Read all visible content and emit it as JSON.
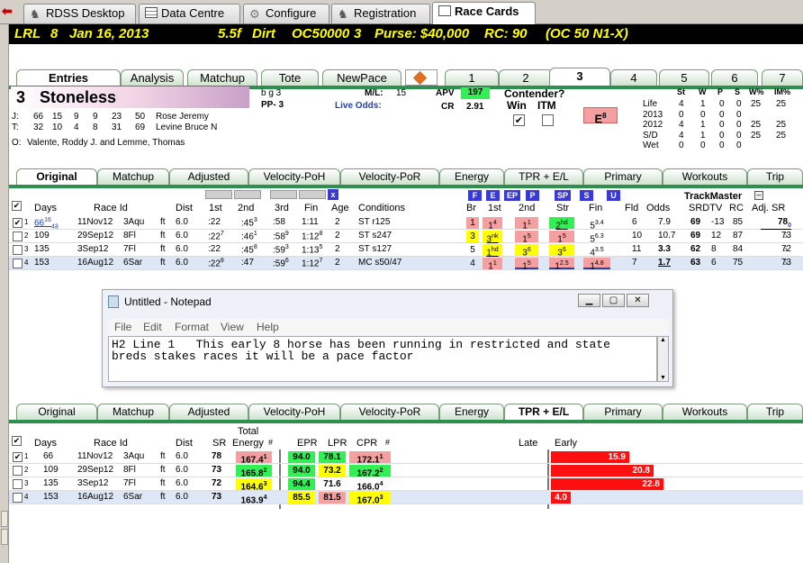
{
  "topTabs": [
    "RDSS Desktop",
    "Data Centre",
    "Configure",
    "Registration",
    "Race Cards"
  ],
  "header": {
    "track": "LRL",
    "race": "8",
    "date": "Jan 16, 2013",
    "dist": "5.5f",
    "surface": "Dirt",
    "cls": "OC50000",
    "num": "3",
    "purse": "Purse: $40,000",
    "rc": "RC: 90",
    "cond": "(OC 50 N1-X)"
  },
  "viewTabs": [
    "Entries",
    "Analysis",
    "Matchup",
    "Tote",
    "NewPace"
  ],
  "horseTabs": [
    "1",
    "2",
    "3",
    "4",
    "5",
    "6",
    "7"
  ],
  "horse": {
    "num": "3",
    "name": "Stoneless",
    "sex": "b g 3",
    "pp": "PP- 3",
    "ml_label": "M/L:",
    "ml": "15",
    "live": "Live Odds:",
    "apv_label": "APV",
    "apv": "197",
    "cr_label": "CR",
    "cr": "2.91",
    "contender": "Contender?",
    "win": "Win",
    "itm": "ITM",
    "e": "E",
    "e_sup": "8"
  },
  "jt": [
    {
      "k": "J:",
      "a": "66",
      "b": "15",
      "c": "9",
      "d": "9",
      "e": "23",
      "f": "50",
      "name": "Rose Jeremy"
    },
    {
      "k": "T:",
      "a": "32",
      "b": "10",
      "c": "4",
      "d": "8",
      "e": "31",
      "f": "69",
      "name": "Levine Bruce N"
    }
  ],
  "owner": {
    "k": "O:",
    "name": "Valente, Roddy J. and Lemme, Thomas"
  },
  "record": {
    "headers": [
      "St",
      "W",
      "P",
      "S",
      "W%",
      "IM%"
    ],
    "rows": [
      {
        "label": "Life",
        "v": [
          "4",
          "1",
          "0",
          "0",
          "25",
          "25"
        ]
      },
      {
        "label": "2013",
        "v": [
          "0",
          "0",
          "0",
          "0",
          "",
          ""
        ]
      },
      {
        "label": "2012",
        "v": [
          "4",
          "1",
          "0",
          "0",
          "25",
          "25"
        ]
      },
      {
        "label": "S/D",
        "v": [
          "4",
          "1",
          "0",
          "0",
          "25",
          "25"
        ]
      },
      {
        "label": "Wet",
        "v": [
          "0",
          "0",
          "0",
          "0",
          "",
          ""
        ]
      }
    ]
  },
  "ppTabs": [
    "Original",
    "Matchup",
    "Adjusted",
    "Velocity-PoH",
    "Velocity-PoR",
    "Energy",
    "TPR + E/L",
    "Primary",
    "Workouts",
    "Trip"
  ],
  "ppHeaders": {
    "days": "Days",
    "raceid": "Race Id",
    "dist": "Dist",
    "c1": "1st",
    "c2": "2nd",
    "c3": "3rd",
    "fin": "Fin",
    "age": "Age",
    "cond": "Conditions",
    "br": "Br",
    "p1": "1st",
    "p2": "2nd",
    "str": "Str",
    "pfin": "Fin",
    "fld": "Fld",
    "odds": "Odds",
    "tm": "TrackMaster",
    "srdtv": "SRDTV",
    "rc": "RC",
    "adj": "Adj. SR",
    "x": "x"
  },
  "ppFlags": [
    "F",
    "E",
    "EP",
    "P",
    "SP",
    "S",
    "U"
  ],
  "ppRows": [
    {
      "n": "1",
      "days": "66",
      "dsup": "16",
      "dsub": "43",
      "date": "11Nov12",
      "trk": "3Aqu",
      "sf": "ft",
      "dist": "6.0",
      "c1": ":22",
      "c2": ":45",
      "c2s": "3",
      "c3": ":58",
      "fin": "1:11",
      "age": "2",
      "cond": "ST r125",
      "br": "1",
      "p1": "1",
      "p1s": "4",
      "p2": "1",
      "p2s": "1",
      "str": "2",
      "strs": "hd",
      "pfin": "5",
      "pfins": "3.4",
      "fld": "6",
      "odds": "7.9",
      "sr": "69",
      "dtv": "-13",
      "rc": "85",
      "adj": "78",
      "adjs": "0",
      "extra": ""
    },
    {
      "n": "2",
      "days": "109",
      "dsup": "",
      "dsub": "",
      "date": "29Sep12",
      "trk": "8Fl",
      "sf": "ft",
      "dist": "6.0",
      "c1": ":22",
      "c1s": "7",
      "c2": ":46",
      "c2s": "1",
      "c3": ":58",
      "c3s": "9",
      "fin": "1:12",
      "fins": "8",
      "age": "2",
      "cond": "ST s247",
      "br": "3",
      "p1": "3",
      "p1s": "nk",
      "p2": "1",
      "p2s": "5",
      "str": "1",
      "strs": "5",
      "pfin": "5",
      "pfins": "6.3",
      "fld": "10",
      "odds": "10.7",
      "sr": "69",
      "dtv": "12",
      "rc": "87",
      "adj": "73",
      "adjs": "",
      "extra": "5"
    },
    {
      "n": "3",
      "days": "135",
      "dsup": "",
      "dsub": "",
      "date": "3Sep12",
      "trk": "7Fl",
      "sf": "ft",
      "dist": "6.0",
      "c1": ":22",
      "c2": ":45",
      "c2s": "8",
      "c3": ":59",
      "c3s": "3",
      "fin": "1:13",
      "fins": "5",
      "age": "2",
      "cond": "ST s127",
      "br": "5",
      "p1": "1",
      "p1s": "hd",
      "p2": "3",
      "p2s": "6",
      "str": "3",
      "strs": "6",
      "pfin": "4",
      "pfins": "3.5",
      "fld": "11",
      "odds": "3.3",
      "sr": "62",
      "dtv": "8",
      "rc": "84",
      "adj": "72",
      "adjs": "",
      "extra": "6"
    },
    {
      "n": "4",
      "days": "153",
      "dsup": "",
      "dsub": "",
      "date": "16Aug12",
      "trk": "6Sar",
      "sf": "ft",
      "dist": "6.0",
      "c1": ":22",
      "c1s": "8",
      "c2": ":47",
      "c3": ":59",
      "c3s": "6",
      "fin": "1:12",
      "fins": "7",
      "age": "2",
      "cond": "MC s50/47",
      "br": "4",
      "p1": "1",
      "p1s": "1",
      "p2": "1",
      "p2s": "5",
      "str": "1",
      "strs": "2.5",
      "pfin": "1",
      "pfins": "4.8",
      "fld": "7",
      "odds": "1.7",
      "sr": "63",
      "dtv": "6",
      "rc": "75",
      "adj": "73",
      "adjs": "",
      "extra": "5"
    }
  ],
  "notepad": {
    "title": "Untitled - Notepad",
    "menu": [
      "File",
      "Edit",
      "Format",
      "View",
      "Help"
    ],
    "text": "H2 Line 1   This early 8 horse has been running in restricted and state\nbreds stakes races it will be a pace factor"
  },
  "energyHeaders": {
    "days": "Days",
    "raceid": "Race Id",
    "dist": "Dist",
    "sr": "SR",
    "total": "Total",
    "energy": "Energy",
    "hash": "#",
    "epr": "EPR",
    "lpr": "LPR",
    "cpr": "CPR",
    "hash2": "#",
    "late": "Late",
    "early": "Early"
  },
  "energyRows": [
    {
      "n": "1",
      "days": "66",
      "date": "11Nov12",
      "trk": "3Aqu",
      "sf": "ft",
      "dist": "6.0",
      "sr": "78",
      "energy": "167.4",
      "es": "1",
      "epr": "94.0",
      "lpr": "78.1",
      "cpr": "172.1",
      "cs": "1",
      "early": "15.9",
      "pct": 0.67
    },
    {
      "n": "2",
      "days": "109",
      "date": "29Sep12",
      "trk": "8Fl",
      "sf": "ft",
      "dist": "6.0",
      "sr": "73",
      "energy": "165.8",
      "es": "2",
      "epr": "94.0",
      "lpr": "73.2",
      "cpr": "167.2",
      "cs": "2",
      "early": "20.8",
      "pct": 0.88
    },
    {
      "n": "3",
      "days": "135",
      "date": "3Sep12",
      "trk": "7Fl",
      "sf": "ft",
      "dist": "6.0",
      "sr": "72",
      "energy": "164.6",
      "es": "3",
      "epr": "94.4",
      "lpr": "71.6",
      "cpr": "166.0",
      "cs": "4",
      "early": "22.8",
      "pct": 0.96
    },
    {
      "n": "4",
      "days": "153",
      "date": "16Aug12",
      "trk": "6Sar",
      "sf": "ft",
      "dist": "6.0",
      "sr": "73",
      "energy": "163.9",
      "es": "4",
      "epr": "85.5",
      "lpr": "81.5",
      "cpr": "167.0",
      "cs": "3",
      "early": "4.0",
      "pct": 0.17
    }
  ]
}
